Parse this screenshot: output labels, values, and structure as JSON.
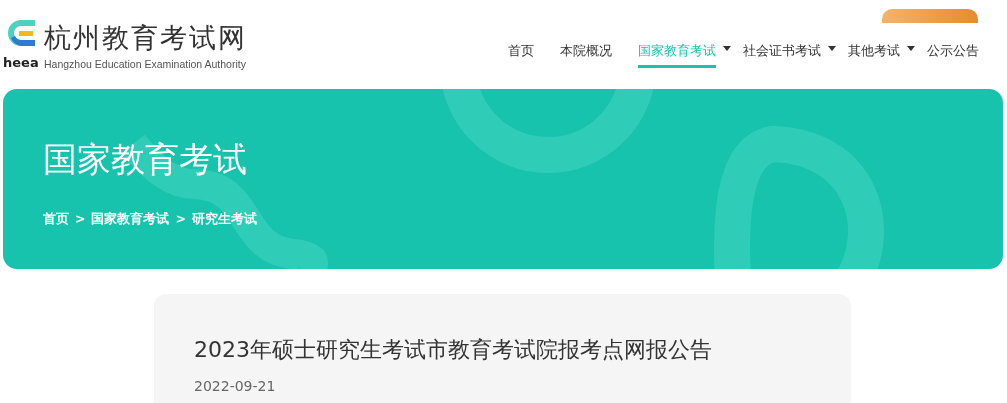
{
  "logo": {
    "mark": "heea",
    "title": "杭州教育考试网",
    "subtitle": "Hangzhou Education Examination Authority"
  },
  "nav": [
    {
      "label": "首页",
      "selected": false,
      "dropdown": false
    },
    {
      "label": "本院概况",
      "selected": false,
      "dropdown": false
    },
    {
      "label": "国家教育考试",
      "selected": true,
      "dropdown": true
    },
    {
      "label": "社会证书考试",
      "selected": false,
      "dropdown": true
    },
    {
      "label": "其他考试",
      "selected": false,
      "dropdown": true
    },
    {
      "label": "公示公告",
      "selected": false,
      "dropdown": false
    }
  ],
  "banner": {
    "title": "国家教育考试",
    "breadcrumb": [
      "首页",
      ">",
      "国家教育考试",
      ">",
      "研究生考试"
    ]
  },
  "article": {
    "title": "2023年硕士研究生考试市教育考试院报考点网报公告",
    "date": "2022-09-21"
  }
}
